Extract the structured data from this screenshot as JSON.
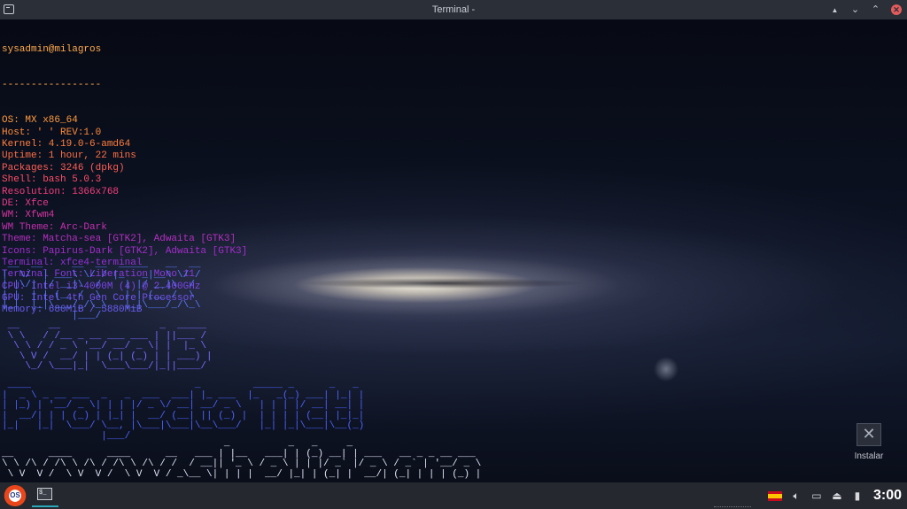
{
  "window": {
    "title": "Terminal -",
    "buttons": {
      "keep_above": "▲",
      "minimize": "⌄",
      "maximize": "⌃",
      "close": "✕"
    }
  },
  "neofetch": {
    "user_host": "sysadmin@milagros",
    "separator": "-----------------",
    "lines": [
      "OS: MX x86_64",
      "Host: ' ' REV:1.0",
      "Kernel: 4.19.0-6-amd64",
      "Uptime: 1 hour, 22 mins",
      "Packages: 3246 (dpkg)",
      "Shell: bash 5.0.3",
      "Resolution: 1366x768",
      "DE: Xfce",
      "WM: Xfwm4",
      "WM Theme: Arc-Dark",
      "Theme: Matcha-sea [GTK2], Adwaita [GTK3]",
      "Icons: Papirus-Dark [GTK2], Adwaita [GTK3]",
      "Terminal: xfce4-terminal",
      "Terminal Font: Liberation Mono 11",
      "CPU: Intel i3-4000M (4) @ 2.400GHz",
      "GPU: Intel 4th Gen Core Processor",
      "Memory: 680MiB / 5880MiB"
    ],
    "line_colors": [
      "#ff9a3c",
      "#ff8c3a",
      "#ff7e3f",
      "#ff7045",
      "#ff5f55",
      "#ff4f66",
      "#f43f7a",
      "#e53a8c",
      "#d4359e",
      "#c530b0",
      "#b42ebf",
      "#a32dcb",
      "#942fd6",
      "#8a3be0",
      "#7d45ea",
      "#7152ef",
      "#6a5cf2"
    ],
    "header_color": "#ffaa4d"
  },
  "ascii_art": {
    "block1": " __  __     __  __  _____   __  __\n|  \\/  | ___\\ \\/ / |_   _|__\\ \\/ /\n| |\\/| |/ __|\\  /    | |/ __|\\  / \n| |  | | (__ /  \\    | | (__ /  \\ \n|_|  |_|\\___/_/\\_\\   |_|\\___/_/\\_\\\n            |___/                 ",
    "block2": " __     __                 _  _____ \n \\ \\   / /__ _ __ ___ ___ | ||___ / \n  \\ \\ / / _ \\ '__/ __/ _ \\| |  |_ \\ \n   \\ V /  __/ | | (_| (_) | | ___) |\n    \\_/ \\___|_|  \\___\\___/|_||____/ ",
    "block3": " ____                            _         _____ _      _   _ \n|  _ \\ _ __ ___  _   _  ___  ___| |_ ___  |_   _(_) ___| |_| |\n| |_) | '__/ _ \\| | | |/ _ \\/ __| __/ _ \\   | | | |/ __| __| |\n|  __/| | | (_) | |_| |  __/ (__| || (_) |  | | | | (__| |_|_|\n|_|   |_|  \\___/ \\__, |\\___|\\___|\\__\\___/   |_| |_|\\___|\\__(_)\n                 |___/                                        ",
    "block4": "                                      _          _   _     _                        \n__      ____      ____      __   ___ | |__   ___| | (_) __| | ___   __ _ _ __ ___  \n\\ \\ /\\ / /\\ \\ /\\ / /\\ \\ /\\ / /  / __|| '_ \\ / _ \\ | | |/ _` |/ _ \\ / _` | '__/ _ \\ \n \\ V  V /  \\ V  V /  \\ V  V / _\\__ \\| | | |  __/ |_| | (_| |  __/| (_| | | | (_) |",
    "colors": [
      "#5a78ff",
      "#7a6bff",
      "#4c63ff",
      "#6f8cff"
    ]
  },
  "desktop": {
    "icon_label": "Instalar",
    "icon_name": "installer-icon"
  },
  "taskbar": {
    "start_label": "OS",
    "active_app": "terminal-icon",
    "active_app_glyph": "$_",
    "tray": [
      "spain-flag-icon",
      "volume-icon",
      "monitor-icon",
      "eject-icon",
      "battery-icon"
    ],
    "clock": "3:00"
  }
}
